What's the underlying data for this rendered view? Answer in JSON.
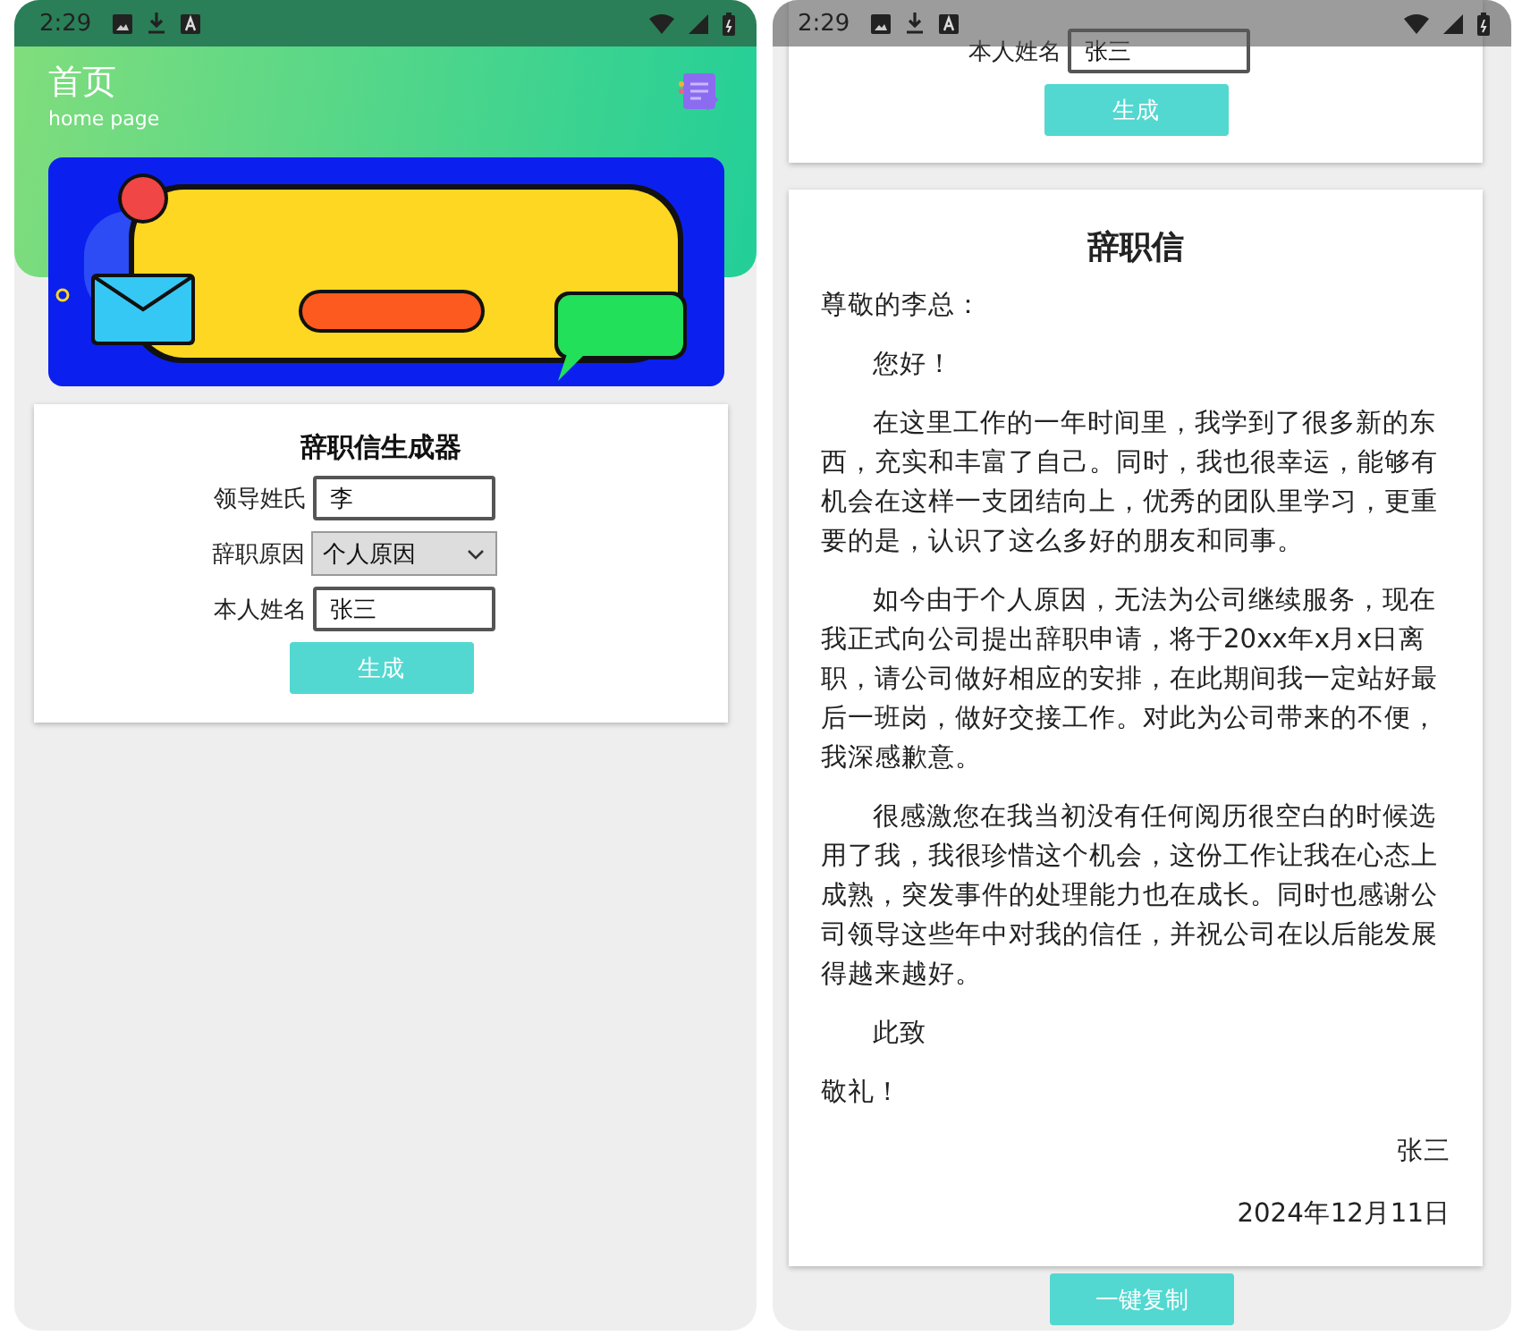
{
  "left_screen": {
    "status_bar": {
      "time": "2:29"
    },
    "header": {
      "title": "首页",
      "subtitle": "home page"
    },
    "form": {
      "title": "辞职信生成器",
      "fields": [
        {
          "label": "领导姓氏",
          "kind": "text",
          "value": "李"
        },
        {
          "label": "辞职原因",
          "kind": "select",
          "value": "个人原因"
        },
        {
          "label": "本人姓名",
          "kind": "text",
          "value": "张三"
        }
      ],
      "button": "生成"
    }
  },
  "right_screen": {
    "status_bar": {
      "time": "2:29"
    },
    "form": {
      "fields": [
        {
          "label": "本人姓名",
          "kind": "text",
          "value": "张三"
        }
      ],
      "button": "生成"
    },
    "letter": {
      "title": "辞职信",
      "blocks": [
        {
          "kind": "plain",
          "text": "尊敬的李总："
        },
        {
          "kind": "indented",
          "text": "您好！"
        },
        {
          "kind": "indented",
          "text": "在这里工作的一年时间里，我学到了很多新的东西，充实和丰富了自己。同时，我也很幸运，能够有机会在这样一支团结向上，优秀的团队里学习，更重要的是，认识了这么多好的朋友和同事。"
        },
        {
          "kind": "indented",
          "text": "如今由于个人原因，无法为公司继续服务，现在我正式向公司提出辞职申请，将于20xx年x月x日离职，请公司做好相应的安排，在此期间我一定站好最后一班岗，做好交接工作。对此为公司带来的不便，我深感歉意。"
        },
        {
          "kind": "indented",
          "text": "很感激您在我当初没有任何阅历很空白的时候选用了我，我很珍惜这个机会，这份工作让我在心态上成熟，突发事件的处理能力也在成长。同时也感谢公司领导这些年中对我的信任，并祝公司在以后能发展得越来越好。"
        },
        {
          "kind": "indented",
          "text": "此致"
        },
        {
          "kind": "plain",
          "text": "敬礼！"
        },
        {
          "kind": "right",
          "text": "张三"
        },
        {
          "kind": "right",
          "text": "2024年12月11日"
        }
      ]
    },
    "copy_button": "一键复制"
  }
}
